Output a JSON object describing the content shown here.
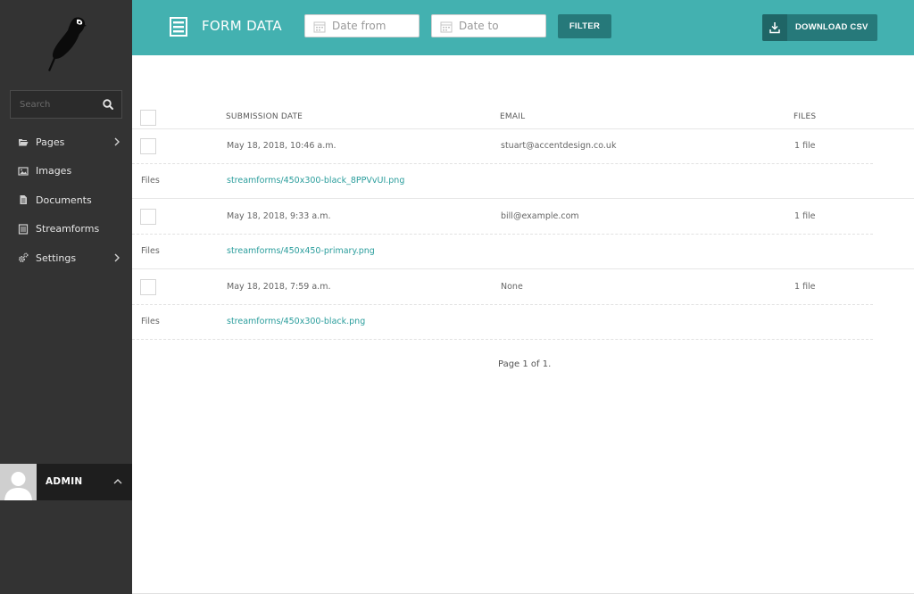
{
  "sidebar": {
    "search_placeholder": "Search",
    "items": [
      {
        "label": "Pages",
        "icon": "folder-open-icon",
        "has_submenu": true
      },
      {
        "label": "Images",
        "icon": "image-icon",
        "has_submenu": false
      },
      {
        "label": "Documents",
        "icon": "doc-full-icon",
        "has_submenu": false
      },
      {
        "label": "Streamforms",
        "icon": "form-icon",
        "has_submenu": false
      },
      {
        "label": "Settings",
        "icon": "cogs-icon",
        "has_submenu": true
      }
    ],
    "account": {
      "name": "ADMIN"
    }
  },
  "header": {
    "title": "FORM DATA",
    "date_from_placeholder": "Date from",
    "date_to_placeholder": "Date to",
    "filter_label": "FILTER",
    "download_label": "DOWNLOAD CSV"
  },
  "table": {
    "columns": [
      "SUBMISSION DATE",
      "EMAIL",
      "FILES"
    ],
    "rows": [
      {
        "date": "May 18, 2018, 10:46 a.m.",
        "email": "stuart@accentdesign.co.uk",
        "files": "1 file",
        "files_label": "Files",
        "file_link": "streamforms/450x300-black_8PPVvUI.png"
      },
      {
        "date": "May 18, 2018, 9:33 a.m.",
        "email": "bill@example.com",
        "files": "1 file",
        "files_label": "Files",
        "file_link": "streamforms/450x450-primary.png"
      },
      {
        "date": "May 18, 2018, 7:59 a.m.",
        "email": "None",
        "files": "1 file",
        "files_label": "Files",
        "file_link": "streamforms/450x300-black.png"
      }
    ]
  },
  "pagination": {
    "text": "Page 1 of 1."
  },
  "colors": {
    "sidebar_bg": "#333333",
    "header_bg": "#43b1b0",
    "button_bg": "#26797a",
    "link": "#2a9d9c"
  }
}
